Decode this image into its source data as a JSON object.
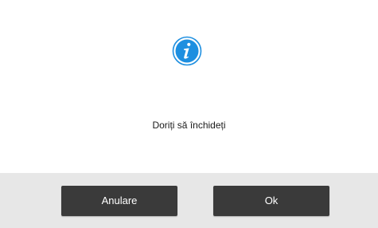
{
  "dialog": {
    "icon": "info-icon",
    "message": "Doriți să închideți",
    "cancel_label": "Anulare",
    "ok_label": "Ok"
  },
  "colors": {
    "icon_blue": "#1e8fe0",
    "button_bg": "#3a3a3a",
    "footer_bg": "#e7e7e7"
  }
}
